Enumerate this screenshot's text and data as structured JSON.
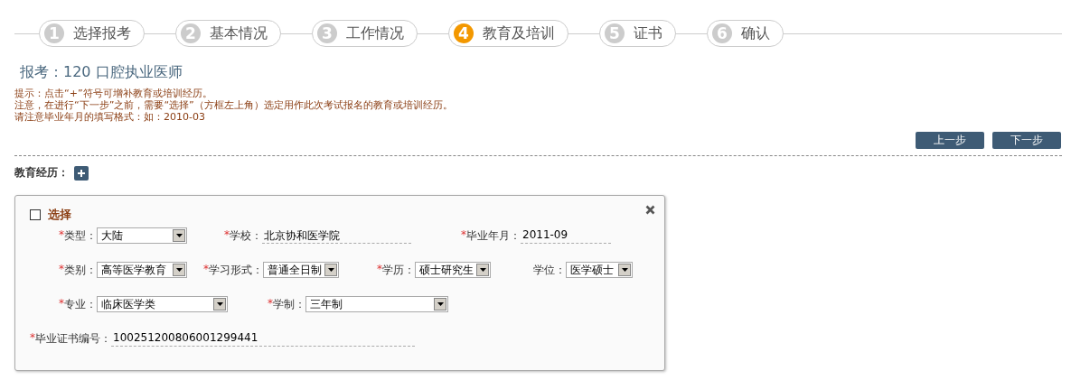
{
  "steps": [
    {
      "number": "1",
      "label": "选择报考",
      "selected": false
    },
    {
      "number": "2",
      "label": "基本情况",
      "selected": false
    },
    {
      "number": "3",
      "label": "工作情况",
      "selected": false
    },
    {
      "number": "4",
      "label": "教育及培训",
      "selected": true
    },
    {
      "number": "5",
      "label": "证书",
      "selected": false
    },
    {
      "number": "6",
      "label": "确认",
      "selected": false
    }
  ],
  "heading": "报考：120 口腔执业医师",
  "notes": [
    "提示：点击“+”符号可增补教育或培训经历。",
    "注意，在进行“下一步”之前，需要“选择”（方框左上角）选定用作此次考试报名的教育或培训经历。",
    "请注意毕业年月的填写格式：如：2010-03"
  ],
  "buttons": [
    "上一步",
    "下一步"
  ],
  "section_label": "教育经历：",
  "record": {
    "select_label": "选择",
    "checked": false,
    "rows": [
      [
        {
          "kind": "select",
          "mark": "*",
          "label": "类型：",
          "value": "大陆"
        },
        {
          "kind": "text",
          "mark": "*",
          "label": "学校：",
          "value": "北京协和医学院"
        },
        {
          "kind": "text",
          "mark": "*",
          "label": "毕业年月：",
          "value": "2011-09"
        }
      ],
      [
        {
          "kind": "select",
          "mark": "*",
          "label": "类别：",
          "value": "高等医学教育"
        },
        {
          "kind": "select",
          "mark": "*",
          "label": "学习形式：",
          "value": "普通全日制"
        },
        {
          "kind": "select",
          "mark": "*",
          "label": "学历：",
          "value": "硕士研究生"
        },
        {
          "kind": "select",
          "label": "学位：",
          "value": "医学硕士"
        }
      ],
      [
        {
          "kind": "select",
          "mark": "*",
          "label": "专业：",
          "value": "临床医学类"
        },
        {
          "kind": "select",
          "mark": "*",
          "label": "学制：",
          "value": "三年制"
        }
      ],
      [
        {
          "kind": "text",
          "mark": "*",
          "label": "毕业证书编号：",
          "value": "100251200806001299441"
        }
      ]
    ]
  }
}
